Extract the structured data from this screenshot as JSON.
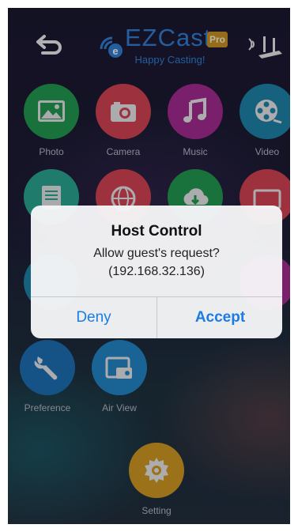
{
  "header": {
    "brand": "EZCast",
    "badge": "Pro",
    "tagline": "Happy Casting!",
    "back_icon": "back-arrow-icon",
    "router_icon": "wifi-router-icon"
  },
  "apps": [
    {
      "label": "Photo",
      "icon": "photo-icon",
      "color": "#1f9a4c"
    },
    {
      "label": "Camera",
      "icon": "camera-icon",
      "color": "#d6404f"
    },
    {
      "label": "Music",
      "icon": "music-icon",
      "color": "#a5288f"
    },
    {
      "label": "Video",
      "icon": "video-reel-icon",
      "color": "#1b84a8"
    },
    {
      "label": "Preference",
      "icon": "wrench-icon",
      "color": "#1a6fb4"
    },
    {
      "label": "Air View",
      "icon": "air-view-icon",
      "color": "#1f87c7"
    },
    {
      "label": "Setting",
      "icon": "gear-icon",
      "color": "#d39a1c"
    }
  ],
  "dialog": {
    "title": "Host Control",
    "message_line1": "Allow guest's request?",
    "message_line2": "(192.168.32.136)",
    "deny_label": "Deny",
    "accept_label": "Accept"
  },
  "colors": {
    "accent": "#1d7be6",
    "brand_blue": "#2f7fd6"
  }
}
